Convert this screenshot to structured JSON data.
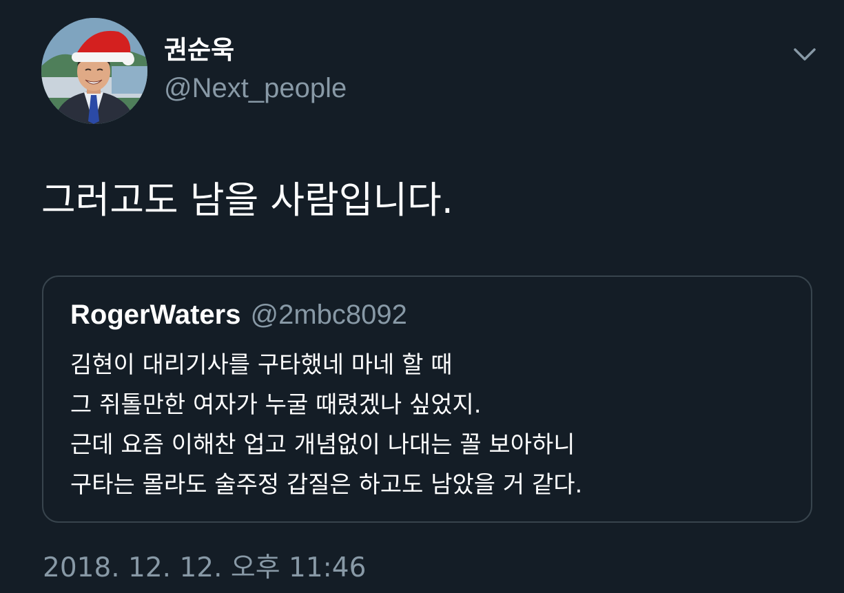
{
  "author": {
    "name": "권순욱",
    "handle": "@Next_people",
    "avatar_icon": "profile-photo-santa-hat"
  },
  "menu_icon": "chevron-down-icon",
  "tweet": {
    "text": "그러고도 남을 사람입니다."
  },
  "quoted_tweet": {
    "author_name": "RogerWaters",
    "author_handle": "@2mbc8092",
    "lines": [
      "김현이 대리기사를 구타했네 마네 할 때",
      "그 쥐톨만한 여자가 누굴 때렸겠나 싶었지.",
      "근데 요즘 이해찬 업고 개념없이 나대는 꼴 보아하니",
      "구타는 몰라도 술주정 갑질은 하고도 남았을 거 같다."
    ]
  },
  "timestamp": "2018. 12. 12. 오후 11:46",
  "colors": {
    "background": "#141d26",
    "primary_text": "#ffffff",
    "secondary_text": "#8899a6",
    "border": "#38444d"
  }
}
